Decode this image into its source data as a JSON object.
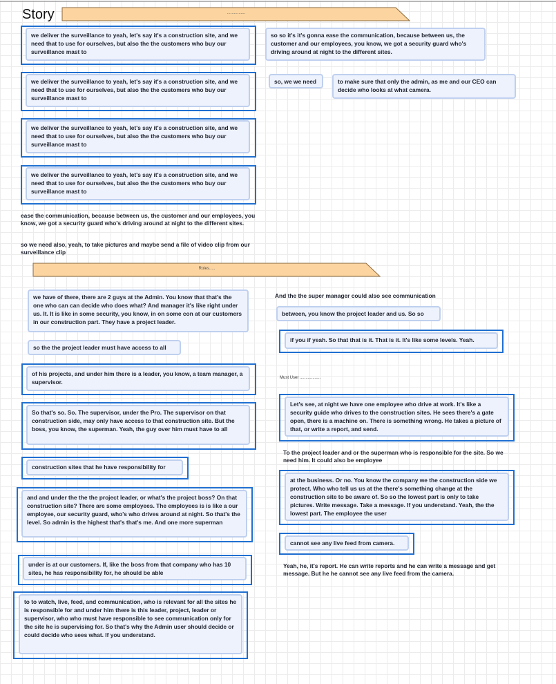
{
  "story": {
    "title": "Story",
    "banner_label": "................",
    "quote_1": "we deliver the surveillance to yeah, let's say it's a construction site, and we need that to use for ourselves, but also the the customers who buy our surveillance mast to",
    "quote_2": "so so it's it's gonna ease the communication, because between us, the customer and our employees, you know, we got a security guard who's driving around at night to the different sites.",
    "quote_3": "so, we we need",
    "quote_4": "to make sure that only the admin, as me and our CEO can decide who looks at what camera.",
    "quote_5": "ease the communication, because between us, the customer and our employees, you know, we got a security guard who's driving around at night to the different sites.",
    "quote_6": "so we need also, yeah, to take pictures and maybe send a file of video clip from our surveillance clip"
  },
  "roles": {
    "banner_label": "Roles.....",
    "left": [
      "we have of there, there are 2 guys at the Admin. You know that that's the one who can can decide who does what? And manager it's like right under us. It. It is like in some security, you know, in on some con at our customers in our construction part. They have a project leader.",
      "so the the project leader must have access to all",
      "of his projects, and under him there is a leader, you know, a team manager, a supervisor.",
      "So that's so. So. The supervisor, under the Pro. The supervisor on that construction side, may only have access to that construction site. But the boss, you know, the superman. Yeah, the guy over him must have to all",
      "construction sites that he have responsibility for",
      "and and under the the the project leader, or what's the project boss? On that construction site? There are some employees. The employees is is like a our employee, our security guard, who's who drives around at night. So that's the level. So admin is the highest that's that's me. And one more superman",
      "under is at our customers. If, like the boss from that company who has 10 sites, he has responsibility for, he should be able",
      "to to watch, live, feed, and communication, who is relevant for all the sites he is responsible for and under him there is this leader, project, leader or supervisor, who who must have responsible to see communication only for the site he is supervising for. So that's why the Admin user should decide or could decide who sees what. If you understand."
    ],
    "right_plain_1": "And the the super manager could also see communication",
    "right_note_1": "between, you know the project leader and us. So so",
    "right_note_2": "if you if yeah. So that that is it. That is it. It's like some levels. Yeah.",
    "must_user_label": "Must User ..................",
    "right_note_3": "Let's see, at night we have one employee who drive at work. It's like a security guide who drives to the construction sites. He sees there's a gate open, there is a machine on. There is something wrong. He takes a picture of that, or write a report, and send.",
    "right_plain_2": "To the project leader and or the superman who is responsible for the site. So we need him. It could also be employee",
    "right_note_4": "at the business. Or no. You know the company we the construction side we protect. Who who tell us us at the there's something change at the construction site to be aware of. So so the lowest part is only to take pictures. Write message. Take a message. If you understand. Yeah, the the lowest part. The employee the user",
    "right_note_5": "cannot see any live feed from camera.",
    "right_plain_3": "Yeah, he, it's report. He can write reports and he can write a message and get message. But he he cannot see any live feed from the camera."
  },
  "colors": {
    "banner_fill": "#fcd4a0",
    "banner_stroke": "#8a6a40",
    "note_fill": "#eef2fc",
    "note_border": "#bfd0ef",
    "frame_border": "#1f6fd1"
  },
  "icons": [
    "horizontal-arrow-banner"
  ]
}
